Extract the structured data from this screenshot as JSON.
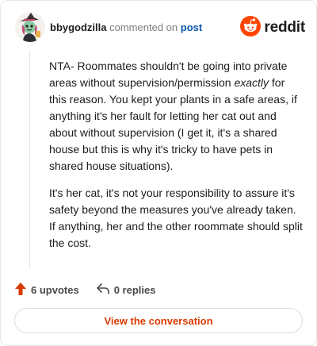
{
  "header": {
    "username": "bbygodzilla",
    "verb": "commented on",
    "post_link": "post",
    "brand": "reddit"
  },
  "comment": {
    "para1_part1": "NTA- Roommates shouldn't be going into private areas without supervision/permission ",
    "para1_emph": "exactly",
    "para1_part2": " for this reason. You kept your plants in a safe areas, if anything it's her fault for letting her cat out and about without supervision (I get it, it's a shared house but this is why it's tricky to have pets in shared house situations).",
    "para2": "It's her cat, it's not your responsibility to assure it's safety beyond the measures you've already taken. If anything, her and the other roommate should split the cost."
  },
  "actions": {
    "upvotes": "6 upvotes",
    "replies": "0 replies"
  },
  "cta": {
    "label": "View the conversation"
  },
  "colors": {
    "brand_orange": "#ff4500",
    "link_blue": "#0a57a8",
    "cta_text": "#d93a00",
    "upvote_orange": "#d93a00"
  },
  "icons": [
    "avatar",
    "reddit-logo-icon",
    "upvote-arrow-icon",
    "reply-icon"
  ]
}
